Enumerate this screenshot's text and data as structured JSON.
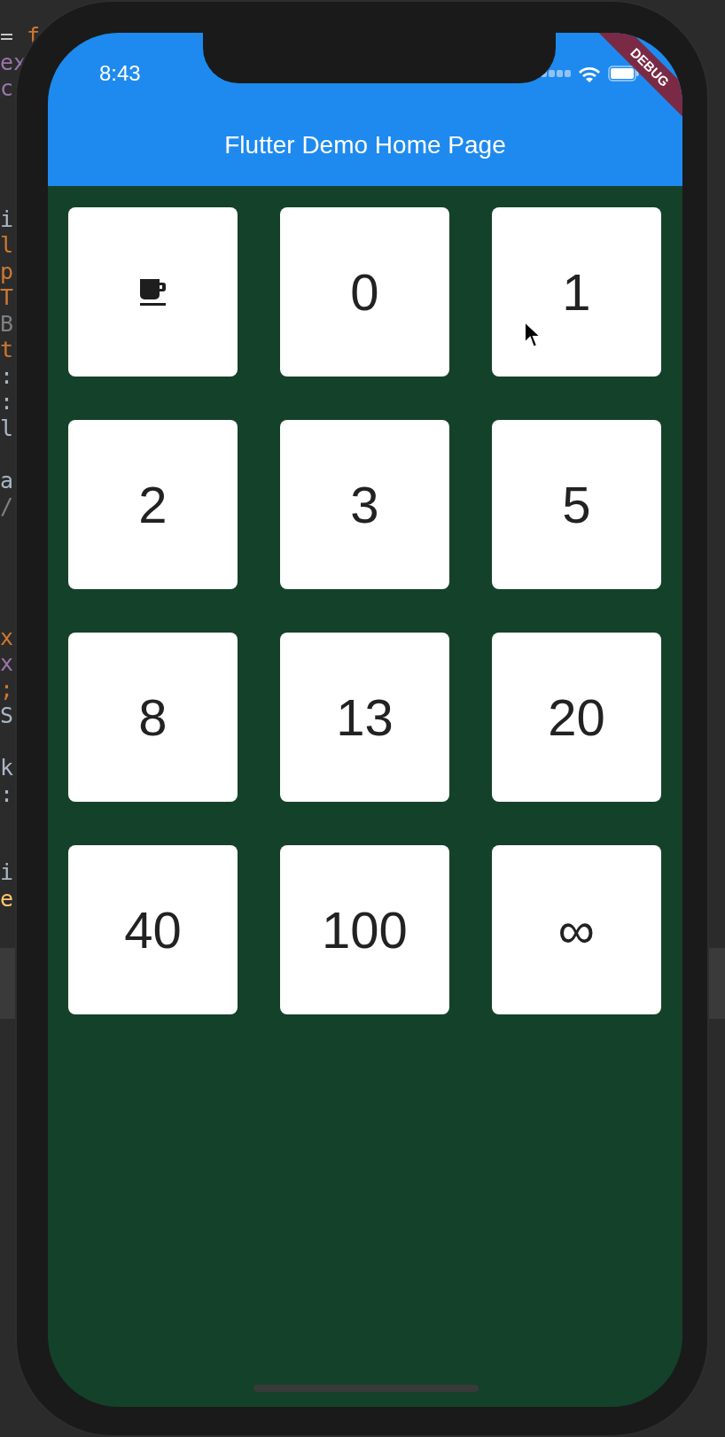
{
  "editor_blocks": [
    {
      "lines": [
        {
          "tokens": [
            {
              "text": "= ",
              "color": "#c8c8c8"
            },
            {
              "text": "f",
              "color": "#cc7832"
            }
          ]
        },
        {
          "tokens": [
            {
              "text": "ex",
              "color": "#9876aa"
            }
          ]
        },
        {
          "tokens": [
            {
              "text": "c",
              "color": "#9876aa"
            }
          ]
        }
      ]
    },
    {
      "lines": [
        {
          "tokens": [
            {
              "text": "i",
              "color": "#a9b7c6"
            }
          ]
        },
        {
          "tokens": [
            {
              "text": "l",
              "color": "#cc7832"
            }
          ]
        },
        {
          "tokens": [
            {
              "text": "p",
              "color": "#cc7832"
            }
          ]
        },
        {
          "tokens": [
            {
              "text": "T",
              "color": "#cc7832"
            }
          ]
        },
        {
          "tokens": [
            {
              "text": "B",
              "color": "#808080"
            }
          ]
        },
        {
          "tokens": [
            {
              "text": "t",
              "color": "#cc7832"
            }
          ]
        },
        {
          "tokens": [
            {
              "text": ":",
              "color": "#a9b7c6"
            }
          ]
        },
        {
          "tokens": [
            {
              "text": ":",
              "color": "#a9b7c6"
            }
          ]
        },
        {
          "tokens": [
            {
              "text": "l",
              "color": "#a9b7c6"
            }
          ]
        }
      ]
    },
    {
      "lines": [
        {
          "tokens": [
            {
              "text": "a",
              "color": "#a9b7c6"
            }
          ]
        },
        {
          "tokens": [
            {
              "text": "/",
              "color": "#808080"
            }
          ]
        }
      ]
    },
    {
      "lines": [
        {
          "tokens": [
            {
              "text": "x",
              "color": "#cc7832"
            }
          ]
        },
        {
          "tokens": [
            {
              "text": "x",
              "color": "#9876aa"
            }
          ]
        },
        {
          "tokens": [
            {
              "text": ";",
              "color": "#cc7832"
            }
          ]
        },
        {
          "tokens": [
            {
              "text": "S",
              "color": "#a9b7c6"
            }
          ]
        }
      ]
    },
    {
      "lines": [
        {
          "tokens": [
            {
              "text": "k",
              "color": "#a9b7c6"
            }
          ]
        },
        {
          "tokens": [
            {
              "text": ":",
              "color": "#a9b7c6"
            }
          ]
        }
      ]
    },
    {
      "lines": [
        {
          "tokens": [
            {
              "text": "i",
              "color": "#a9b7c6"
            }
          ]
        },
        {
          "tokens": [
            {
              "text": "e",
              "color": "#ffc66d"
            }
          ]
        }
      ]
    }
  ],
  "status_bar": {
    "time": "8:43"
  },
  "debug_banner": {
    "label": "DEBUG"
  },
  "app_bar": {
    "title": "Flutter Demo Home Page"
  },
  "tiles": [
    {
      "kind": "icon"
    },
    {
      "kind": "text",
      "label": "0"
    },
    {
      "kind": "text",
      "label": "1"
    },
    {
      "kind": "text",
      "label": "2"
    },
    {
      "kind": "text",
      "label": "3"
    },
    {
      "kind": "text",
      "label": "5"
    },
    {
      "kind": "text",
      "label": "8"
    },
    {
      "kind": "text",
      "label": "13"
    },
    {
      "kind": "text",
      "label": "20"
    },
    {
      "kind": "text",
      "label": "40"
    },
    {
      "kind": "text",
      "label": "100"
    },
    {
      "kind": "text",
      "label": "∞"
    }
  ]
}
